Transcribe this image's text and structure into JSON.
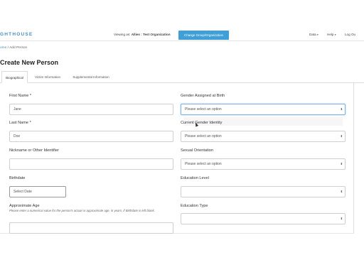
{
  "header": {
    "brand": "GHTHOUSE",
    "viewing_prefix": "Viewing as:",
    "viewing_value": "Allies : Test Organization",
    "change_button": "Change Group/Organization",
    "menu_data": "Data",
    "menu_help": "Help",
    "menu_logout": "Log Ou"
  },
  "breadcrumb": {
    "home": "ome",
    "separator": "/",
    "current": "Add Person"
  },
  "page_title": "Create New Person",
  "tabs": [
    {
      "label": "Biographical"
    },
    {
      "label": "Victim Information"
    },
    {
      "label": "Supplemental Information"
    }
  ],
  "form": {
    "first_name": {
      "label": "First Name *",
      "value": "Jane"
    },
    "last_name": {
      "label": "Last Name *",
      "value": "Doe"
    },
    "nickname": {
      "label": "Nickname or Other Identifier",
      "value": ""
    },
    "birthdate": {
      "label": "Birthdate",
      "placeholder": "Select Date"
    },
    "approx_age": {
      "label": "Approximate Age",
      "help": "Please enter a numerical value for the person's actual or approximate age, in years, if Birthdate is left blank."
    },
    "gender_birth": {
      "label": "Gender Assigned at Birth",
      "selected": "Please select an option"
    },
    "gender_identity": {
      "label": "Current Gender Identity",
      "selected": "Please select an option"
    },
    "sexual_orientation": {
      "label": "Sexual Orientation",
      "selected": "Please select an option"
    },
    "education_level": {
      "label": "Education Level",
      "selected": ""
    },
    "education_type": {
      "label": "Education Type",
      "selected": ""
    }
  },
  "icons": {
    "select_arrows": "up-down-arrows-icon",
    "cursor": "mouse-pointer-icon"
  }
}
